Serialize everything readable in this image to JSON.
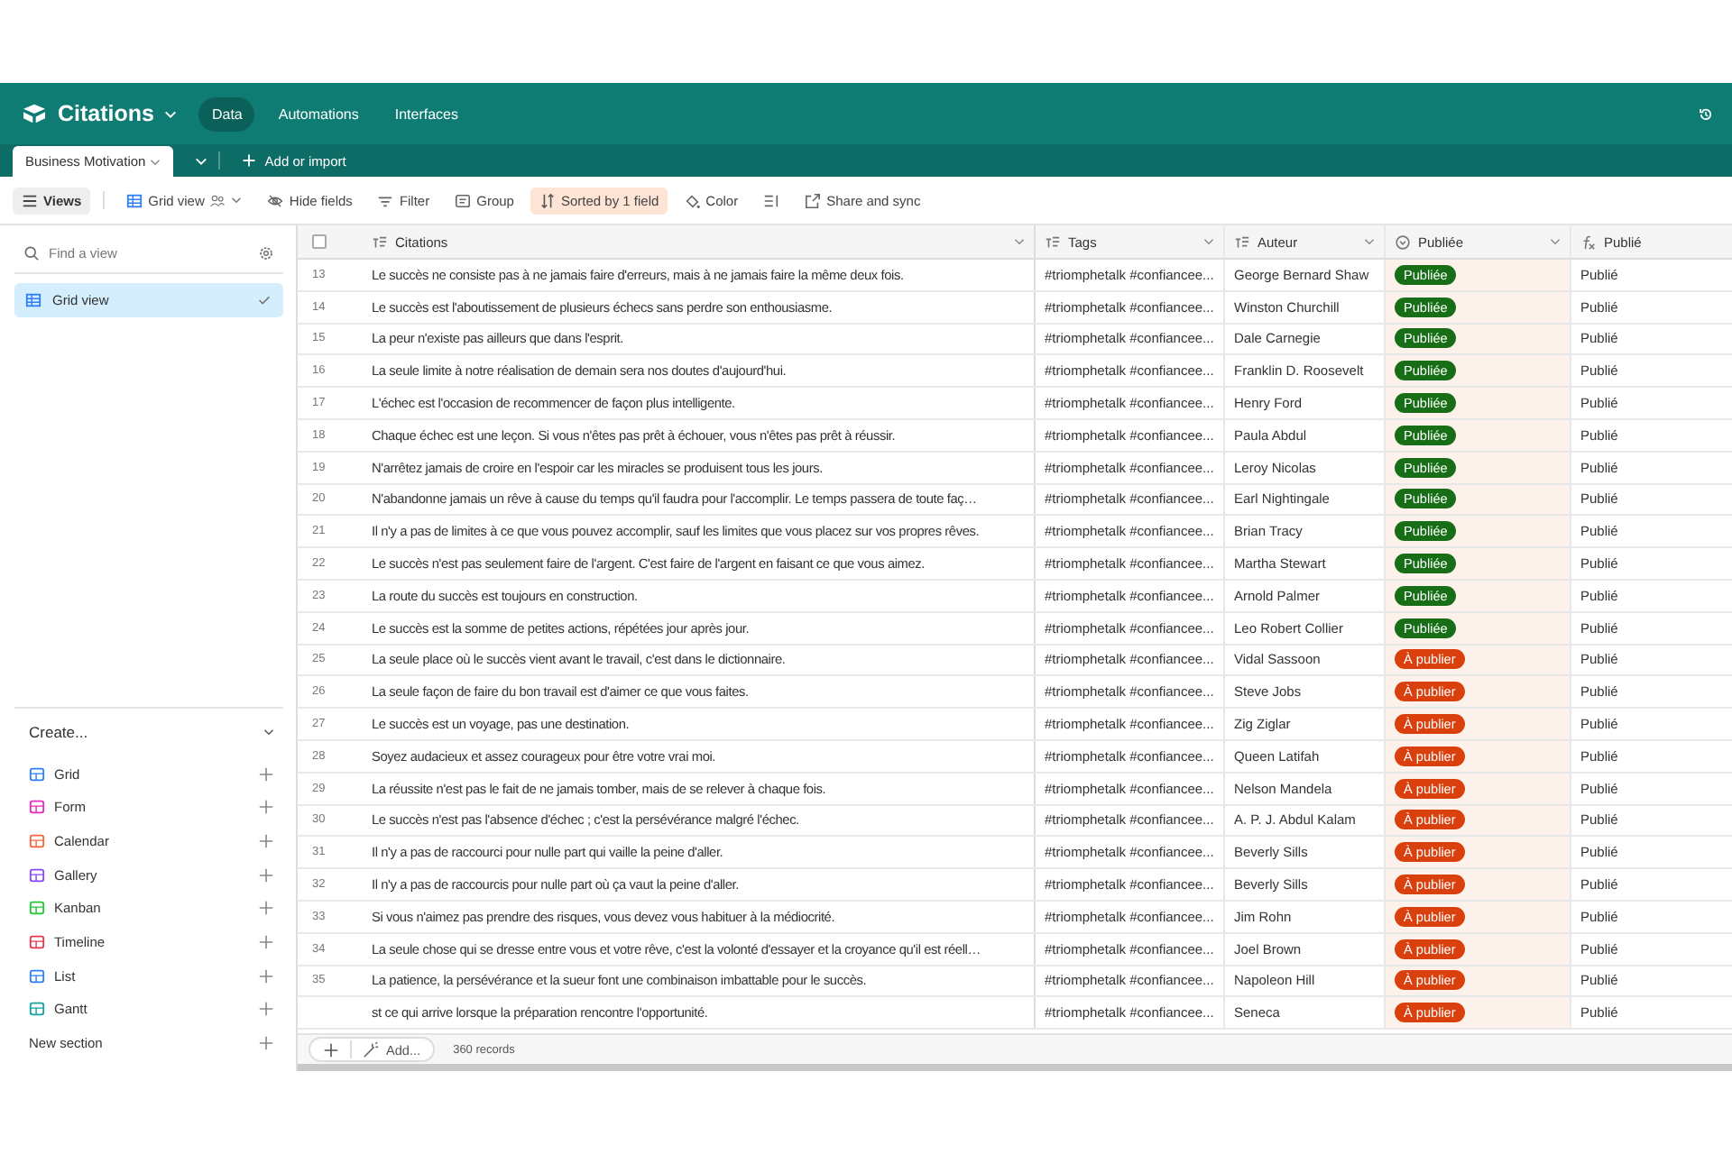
{
  "app": {
    "title": "Citations",
    "nav": [
      {
        "label": "Data",
        "selected": true
      },
      {
        "label": "Automations",
        "selected": false
      },
      {
        "label": "Interfaces",
        "selected": false
      }
    ]
  },
  "tabs": [
    {
      "label": "Business Motivation",
      "selected": true
    }
  ],
  "add_import": "Add or import",
  "toolbar": {
    "views": "Views",
    "view_name": "Grid view",
    "tools": [
      {
        "kind": "hide",
        "label": "Hide fields",
        "active": false
      },
      {
        "kind": "filter",
        "label": "Filter",
        "active": false
      },
      {
        "kind": "group",
        "label": "Group",
        "active": false
      },
      {
        "kind": "sort",
        "label": "Sorted by 1 field",
        "active": true
      },
      {
        "kind": "color",
        "label": "Color",
        "active": false
      },
      {
        "kind": "height",
        "active": false
      },
      {
        "kind": "share",
        "label": "Share and sync",
        "active": false
      }
    ]
  },
  "sidebar": {
    "search_placeholder": "Find a view",
    "views": [
      {
        "label": "Grid view",
        "selected": true
      }
    ],
    "create_title": "Create...",
    "create_items": [
      {
        "kind": "grid",
        "label": "Grid"
      },
      {
        "kind": "form",
        "label": "Form"
      },
      {
        "kind": "calendar",
        "label": "Calendar"
      },
      {
        "kind": "gallery",
        "label": "Gallery"
      },
      {
        "kind": "kanban",
        "label": "Kanban"
      },
      {
        "kind": "timeline",
        "label": "Timeline"
      },
      {
        "kind": "list",
        "label": "List"
      },
      {
        "kind": "gantt",
        "label": "Gantt"
      }
    ],
    "new_section": "New section"
  },
  "table": {
    "select_all_checked": false,
    "columns": [
      {
        "kind": "text",
        "label": "Citations"
      },
      {
        "kind": "text",
        "label": "Tags"
      },
      {
        "kind": "text",
        "label": "Auteur"
      },
      {
        "kind": "select",
        "label": "Publiée"
      },
      {
        "kind": "formula",
        "label": "Publié"
      }
    ],
    "rows": [
      {
        "n": "13",
        "quote": "Le succès ne consiste pas à ne jamais faire d'erreurs, mais à ne jamais faire la même deux fois.",
        "tags": "#triomphetalk #confiancee...",
        "author": "George Bernard Shaw",
        "status": {
          "label": "Publiée",
          "color": "#176e17"
        },
        "formula": "Publié"
      },
      {
        "n": "14",
        "quote": "Le succès est l'aboutissement de plusieurs échecs sans perdre son enthousiasme.",
        "tags": "#triomphetalk #confiancee...",
        "author": "Winston Churchill",
        "status": {
          "label": "Publiée",
          "color": "#176e17"
        },
        "formula": "Publié"
      },
      {
        "n": "15",
        "quote": "La peur n'existe pas ailleurs que dans l'esprit.",
        "tags": "#triomphetalk #confiancee...",
        "author": "Dale Carnegie",
        "status": {
          "label": "Publiée",
          "color": "#176e17"
        },
        "formula": "Publié"
      },
      {
        "n": "16",
        "quote": "La seule limite à notre réalisation de demain sera nos doutes d'aujourd'hui.",
        "tags": "#triomphetalk #confiancee...",
        "author": "Franklin D. Roosevelt",
        "status": {
          "label": "Publiée",
          "color": "#176e17"
        },
        "formula": "Publié"
      },
      {
        "n": "17",
        "quote": "L'échec est l'occasion de recommencer de façon plus intelligente.",
        "tags": "#triomphetalk #confiancee...",
        "author": "Henry Ford",
        "status": {
          "label": "Publiée",
          "color": "#176e17"
        },
        "formula": "Publié"
      },
      {
        "n": "18",
        "quote": "Chaque échec est une leçon. Si vous n'êtes pas prêt à échouer, vous n'êtes pas prêt à réussir.",
        "tags": "#triomphetalk #confiancee...",
        "author": "Paula Abdul",
        "status": {
          "label": "Publiée",
          "color": "#176e17"
        },
        "formula": "Publié"
      },
      {
        "n": "19",
        "quote": "N'arrêtez jamais de croire en l'espoir car les miracles se produisent tous les jours.",
        "tags": "#triomphetalk #confiancee...",
        "author": "Leroy Nicolas",
        "status": {
          "label": "Publiée",
          "color": "#176e17"
        },
        "formula": "Publié"
      },
      {
        "n": "20",
        "quote": "N'abandonne jamais un rêve à cause du temps qu'il faudra pour l'accomplir. Le temps passera de toute faç…",
        "tags": "#triomphetalk #confiancee...",
        "author": "Earl Nightingale",
        "status": {
          "label": "Publiée",
          "color": "#176e17"
        },
        "formula": "Publié"
      },
      {
        "n": "21",
        "quote": "Il n'y a pas de limites à ce que vous pouvez accomplir, sauf les limites que vous placez sur vos propres rêves.",
        "tags": "#triomphetalk #confiancee...",
        "author": "Brian Tracy",
        "status": {
          "label": "Publiée",
          "color": "#176e17"
        },
        "formula": "Publié"
      },
      {
        "n": "22",
        "quote": "Le succès n'est pas seulement faire de l'argent. C'est faire de l'argent en faisant ce que vous aimez.",
        "tags": "#triomphetalk #confiancee...",
        "author": "Martha Stewart",
        "status": {
          "label": "Publiée",
          "color": "#176e17"
        },
        "formula": "Publié"
      },
      {
        "n": "23",
        "quote": "La route du succès est toujours en construction.",
        "tags": "#triomphetalk #confiancee...",
        "author": "Arnold Palmer",
        "status": {
          "label": "Publiée",
          "color": "#176e17"
        },
        "formula": "Publié"
      },
      {
        "n": "24",
        "quote": "Le succès est la somme de petites actions, répétées jour après jour.",
        "tags": "#triomphetalk #confiancee...",
        "author": "Leo Robert Collier",
        "status": {
          "label": "Publiée",
          "color": "#176e17"
        },
        "formula": "Publié"
      },
      {
        "n": "25",
        "quote": "La seule place où le succès vient avant le travail, c'est dans le dictionnaire.",
        "tags": "#triomphetalk #confiancee...",
        "author": "Vidal Sassoon",
        "status": {
          "label": "À publier",
          "color": "#d9400e"
        },
        "formula": "Publié"
      },
      {
        "n": "26",
        "quote": "La seule façon de faire du bon travail est d'aimer ce que vous faites.",
        "tags": "#triomphetalk #confiancee...",
        "author": "Steve Jobs",
        "status": {
          "label": "À publier",
          "color": "#d9400e"
        },
        "formula": "Publié"
      },
      {
        "n": "27",
        "quote": "Le succès est un voyage, pas une destination.",
        "tags": "#triomphetalk #confiancee...",
        "author": "Zig Ziglar",
        "status": {
          "label": "À publier",
          "color": "#d9400e"
        },
        "formula": "Publié"
      },
      {
        "n": "28",
        "quote": "Soyez audacieux et assez courageux pour être votre vrai moi.",
        "tags": "#triomphetalk #confiancee...",
        "author": "Queen Latifah",
        "status": {
          "label": "À publier",
          "color": "#d9400e"
        },
        "formula": "Publié"
      },
      {
        "n": "29",
        "quote": "La réussite n'est pas le fait de ne jamais tomber, mais de se relever à chaque fois.",
        "tags": "#triomphetalk #confiancee...",
        "author": "Nelson Mandela",
        "status": {
          "label": "À publier",
          "color": "#d9400e"
        },
        "formula": "Publié"
      },
      {
        "n": "30",
        "quote": "Le succès n'est pas l'absence d'échec ; c'est la persévérance malgré l'échec.",
        "tags": "#triomphetalk #confiancee...",
        "author": "A. P. J. Abdul Kalam",
        "status": {
          "label": "À publier",
          "color": "#d9400e"
        },
        "formula": "Publié"
      },
      {
        "n": "31",
        "quote": "Il n'y a pas de raccourci pour nulle part qui vaille la peine d'aller.",
        "tags": "#triomphetalk #confiancee...",
        "author": "Beverly Sills",
        "status": {
          "label": "À publier",
          "color": "#d9400e"
        },
        "formula": "Publié"
      },
      {
        "n": "32",
        "quote": "Il n'y a pas de raccourcis pour nulle part où ça vaut la peine d'aller.",
        "tags": "#triomphetalk #confiancee...",
        "author": "Beverly Sills",
        "status": {
          "label": "À publier",
          "color": "#d9400e"
        },
        "formula": "Publié"
      },
      {
        "n": "33",
        "quote": "Si vous n'aimez pas prendre des risques, vous devez vous habituer à la médiocrité.",
        "tags": "#triomphetalk #confiancee...",
        "author": "Jim Rohn",
        "status": {
          "label": "À publier",
          "color": "#d9400e"
        },
        "formula": "Publié"
      },
      {
        "n": "34",
        "quote": "La seule chose qui se dresse entre vous et votre rêve, c'est la volonté d'essayer et la croyance qu'il est réell…",
        "tags": "#triomphetalk #confiancee...",
        "author": "Joel Brown",
        "status": {
          "label": "À publier",
          "color": "#d9400e"
        },
        "formula": "Publié"
      },
      {
        "n": "35",
        "quote": "La patience, la persévérance et la sueur font une combinaison imbattable pour le succès.",
        "tags": "#triomphetalk #confiancee...",
        "author": "Napoleon Hill",
        "status": {
          "label": "À publier",
          "color": "#d9400e"
        },
        "formula": "Publié"
      },
      {
        "n": "",
        "quote": "st ce qui arrive lorsque la préparation rencontre l'opportunité.",
        "tags": "#triomphetalk #confiancee...",
        "author": "Seneca",
        "status": {
          "label": "À publier",
          "color": "#d9400e"
        },
        "formula": "Publié"
      }
    ],
    "add_label": "Add...",
    "record_count": "360 records"
  }
}
